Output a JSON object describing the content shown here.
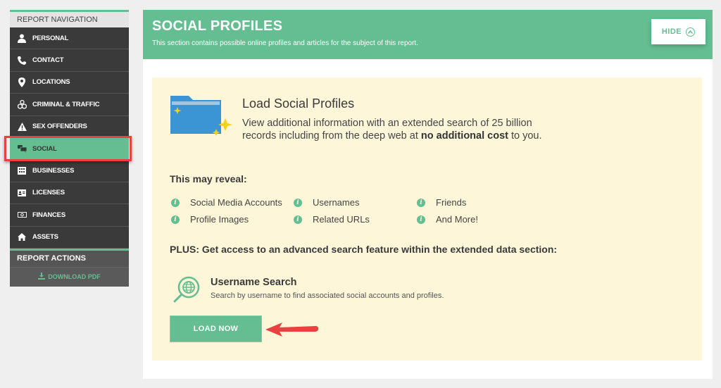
{
  "sidebar": {
    "header": "REPORT NAVIGATION",
    "items": [
      {
        "label": "PERSONAL",
        "icon": "person-icon"
      },
      {
        "label": "CONTACT",
        "icon": "phone-icon"
      },
      {
        "label": "LOCATIONS",
        "icon": "map-pin-icon"
      },
      {
        "label": "CRIMINAL & TRAFFIC",
        "icon": "handcuffs-icon"
      },
      {
        "label": "SEX OFFENDERS",
        "icon": "warning-icon"
      },
      {
        "label": "SOCIAL",
        "icon": "chat-bubbles-icon",
        "active": true
      },
      {
        "label": "BUSINESSES",
        "icon": "building-icon"
      },
      {
        "label": "LICENSES",
        "icon": "id-card-icon"
      },
      {
        "label": "FINANCES",
        "icon": "money-icon"
      },
      {
        "label": "ASSETS",
        "icon": "home-icon"
      }
    ],
    "actions_header": "REPORT ACTIONS",
    "download_label": "DOWNLOAD PDF"
  },
  "section": {
    "title": "SOCIAL PROFILES",
    "subtitle": "This section contains possible online profiles and articles for the subject of this report.",
    "hide_label": "HIDE"
  },
  "promo": {
    "title": "Load Social Profiles",
    "desc_prefix": "View additional information with an extended search of 25 billion records including from the deep web at ",
    "desc_bold": "no additional cost",
    "desc_suffix": " to you.",
    "reveal_heading": "This may reveal:",
    "reveal_items": [
      "Social Media Accounts",
      "Usernames",
      "Friends",
      "Profile Images",
      "Related URLs",
      "And More!"
    ],
    "plus_text": "PLUS: Get access to an advanced search feature within the extended data section:",
    "feature_title": "Username Search",
    "feature_desc": "Search by username to find associated social accounts and profiles.",
    "load_button": "LOAD NOW"
  },
  "colors": {
    "accent": "#64be91",
    "sidebar_bg": "#3a3a3a",
    "promo_bg": "#fef6d8",
    "highlight": "#e9413f"
  }
}
